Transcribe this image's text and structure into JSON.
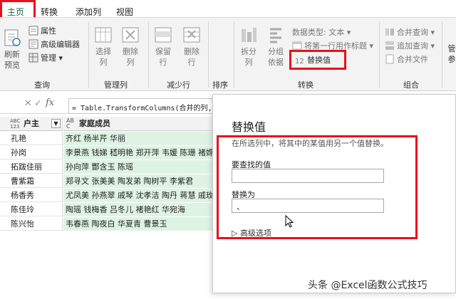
{
  "tabs": [
    "主页",
    "转换",
    "添加列",
    "视图"
  ],
  "ribbon": {
    "query_group": {
      "refresh": "刷新\n预览",
      "properties": "属性",
      "advanced_editor": "高级编辑器",
      "manage": "管理 ▾",
      "label": "查询"
    },
    "manage_columns": {
      "choose": "选择\n列",
      "remove": "删除\n列",
      "label": "管理列"
    },
    "reduce_rows": {
      "keep": "保留\n行",
      "remove": "删除\n行",
      "label": "减少行"
    },
    "sort": {
      "label": "排序"
    },
    "transform": {
      "split": "拆分\n列",
      "group_by": "分组\n依据",
      "data_type": "数据类型: 文本 ▾",
      "first_row_header": "将第一行用作标题 ▾",
      "replace_values": "替换值",
      "label": "转换"
    },
    "combine": {
      "merge_queries": "合并查询 ▾",
      "append_queries": "追加查询 ▾",
      "merge_files": "合并文件",
      "label": "组合"
    },
    "params": {
      "text": "管\n参"
    }
  },
  "formula": {
    "fx": "fx",
    "text": "= Table.TransformColumns(合并的列,"
  },
  "table": {
    "col1_type": "ABC\n123",
    "col1": "户主",
    "col2_type": "AB\nC",
    "col2": "家庭成员",
    "rows": [
      [
        "孔艳",
        "齐红 杨半芹 华丽"
      ],
      [
        "孙岗",
        "李景燕 钱娣 嵇明艳 郑开萍 韦媛 陈珊 褚嫦"
      ],
      [
        "拓跋佳丽",
        "孙向萍 酆含玉 陈瑶"
      ],
      [
        "曹紫霜",
        "郑寻文 张美美 陶发弟 陶树平 李紫君"
      ],
      [
        "杨香秀",
        "尤凤美 孙燕翠 戚琴 沈孝洁 陶丹 蒋慧 戚玫"
      ],
      [
        "陈佳玲",
        "陶瑶 钱梅香 吕冬儿 褚艳红 华宛海"
      ],
      [
        "陈兴怡",
        "韦春燕 陶夜白 华夏青 曹景玉"
      ]
    ]
  },
  "dialog": {
    "title": "替换值",
    "description": "在所选列中，将其中的某值用另一个值替换。",
    "find_label": "要查找的值",
    "find_value": "",
    "replace_label": "替换为",
    "replace_value": "、",
    "advanced": "▷ 高级选项"
  },
  "watermark": "头条 @Excel函数公式技巧",
  "colors": {
    "highlight": "#e8101a",
    "accent": "#1b6d3c",
    "column_fill": "#dff3e4"
  }
}
